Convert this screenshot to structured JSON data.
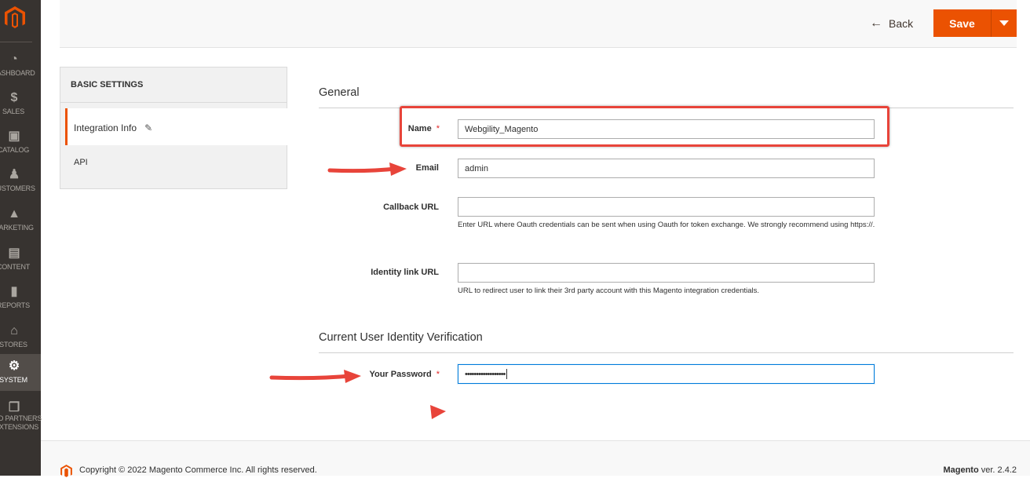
{
  "menu": {
    "items": [
      {
        "label": "DASHBOARD",
        "icon": "dashboard-icon"
      },
      {
        "label": "SALES",
        "icon": "dollar-icon"
      },
      {
        "label": "CATALOG",
        "icon": "cube-icon"
      },
      {
        "label": "CUSTOMERS",
        "icon": "person-icon"
      },
      {
        "label": "MARKETING",
        "icon": "megaphone-icon"
      },
      {
        "label": "CONTENT",
        "icon": "layout-icon"
      },
      {
        "label": "REPORTS",
        "icon": "bar-chart-icon"
      },
      {
        "label": "STORES",
        "icon": "store-icon"
      },
      {
        "label": "SYSTEM",
        "icon": "gear-icon"
      },
      {
        "label": "FIND PARTNERS",
        "label2": "& EXTENSIONS",
        "icon": "boxes-icon"
      }
    ],
    "accent": "#eb5202"
  },
  "header": {
    "back_label": "Back",
    "save_label": "Save"
  },
  "tabs": {
    "title": "BASIC SETTINGS",
    "active": "Integration Info",
    "other": "API"
  },
  "general": {
    "title": "General",
    "name_label": "Name",
    "name_value": "Webgility_Magento",
    "email_label": "Email",
    "email_value": "admin",
    "callback_label": "Callback URL",
    "callback_value": "",
    "callback_note": "Enter URL where Oauth credentials can be sent when using Oauth for token exchange. We strongly recommend using https://.",
    "identity_label": "Identity link URL",
    "identity_value": "",
    "identity_note": "URL to redirect user to link their 3rd party account with this Magento integration credentials."
  },
  "verification": {
    "title": "Current User Identity Verification",
    "password_label": "Your Password",
    "password_value": "••••••••••••••••••"
  },
  "footer": {
    "copyright": "Copyright © 2022 Magento Commerce Inc. All rights reserved.",
    "brand": "Magento",
    "version": " ver. 2.4.2"
  }
}
